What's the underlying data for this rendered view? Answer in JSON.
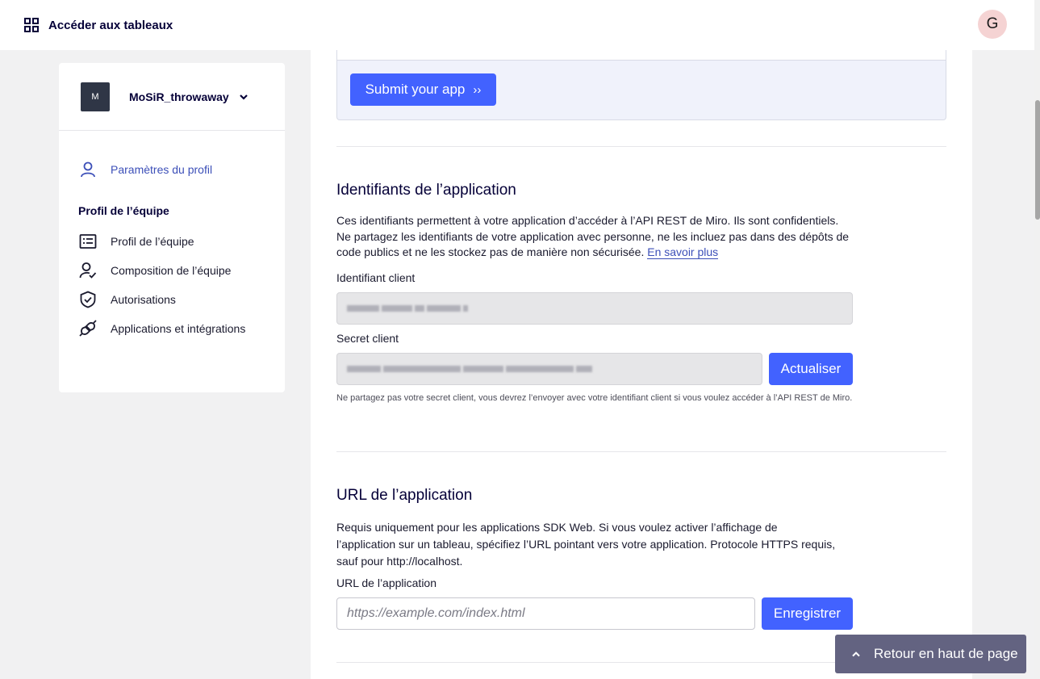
{
  "topbar": {
    "boards_label": "Accéder aux tableaux",
    "avatar_initial": "G"
  },
  "sidebar": {
    "team_initial": "M",
    "team_name": "MoSiR_throwaway",
    "profile_settings": "Paramètres du profil",
    "team_section_title": "Profil de l’équipe",
    "items": [
      {
        "label": "Profil de l’équipe",
        "icon": "list-card-icon"
      },
      {
        "label": "Composition de l’équipe",
        "icon": "user-check-icon"
      },
      {
        "label": "Autorisations",
        "icon": "shield-check-icon"
      },
      {
        "label": "Applications et intégrations",
        "icon": "plug-icon"
      }
    ]
  },
  "submit": {
    "label": "Submit your app"
  },
  "credentials": {
    "title": "Identifiants de l’application",
    "description": "Ces identifiants permettent à votre application d’accéder à l’API REST de Miro. Ils sont confidentiels. Ne partagez les identifiants de votre application avec personne, ne les incluez pas dans des dépôts de code publics et ne les stockez pas de manière non sécurisée.",
    "learn_more": "En savoir plus",
    "client_id_label": "Identifiant client",
    "client_secret_label": "Secret client",
    "refresh_label": "Actualiser",
    "secret_note": "Ne partagez pas votre secret client, vous devrez l’envoyer avec votre identifiant client si vous voulez accéder à l’API REST de Miro."
  },
  "app_url": {
    "title": "URL de l’application",
    "description": "Requis uniquement pour les applications SDK Web. Si vous voulez activer l’affichage de l’application sur un tableau, spécifiez l’URL pointant vers votre application. Protocole HTTPS requis, sauf pour http://localhost.",
    "field_label": "URL de l’application",
    "placeholder": "https://example.com/index.html",
    "save_label": "Enregistrer"
  },
  "back_to_top": {
    "label": "Retour en haut de page"
  },
  "colors": {
    "primary": "#4262ff",
    "link": "#3c4fb8",
    "back_to_top_bg": "#636381"
  }
}
